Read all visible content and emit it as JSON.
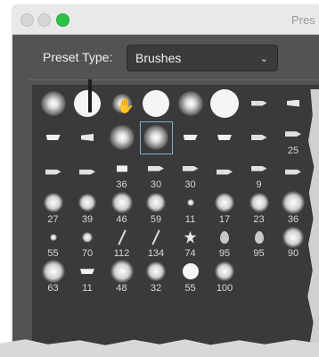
{
  "window": {
    "title": "Pres"
  },
  "preset": {
    "label": "Preset Type:",
    "value": "Brushes"
  },
  "brushes": [
    {
      "shape": "soft",
      "size": 28,
      "num": ""
    },
    {
      "shape": "hard",
      "size": 30,
      "num": ""
    },
    {
      "shape": "soft",
      "size": 22,
      "num": ""
    },
    {
      "shape": "hard",
      "size": 30,
      "num": ""
    },
    {
      "shape": "soft",
      "size": 28,
      "num": ""
    },
    {
      "shape": "hard",
      "size": 32,
      "num": ""
    },
    {
      "shape": "tip-c",
      "size": 0,
      "num": ""
    },
    {
      "shape": "tip-b",
      "size": 0,
      "num": ""
    },
    {
      "shape": "tip-a",
      "size": 0,
      "num": ""
    },
    {
      "shape": "tip-b",
      "size": 0,
      "num": ""
    },
    {
      "shape": "soft",
      "size": 28,
      "num": ""
    },
    {
      "shape": "soft",
      "size": 28,
      "num": "",
      "selected": true
    },
    {
      "shape": "tip-a",
      "size": 0,
      "num": ""
    },
    {
      "shape": "tip-a",
      "size": 0,
      "num": ""
    },
    {
      "shape": "tip-c",
      "size": 0,
      "num": ""
    },
    {
      "shape": "tip-c",
      "size": 0,
      "num": "25"
    },
    {
      "shape": "tip-c",
      "size": 0,
      "num": ""
    },
    {
      "shape": "tip-c",
      "size": 0,
      "num": ""
    },
    {
      "shape": "tip-d",
      "size": 0,
      "num": "36"
    },
    {
      "shape": "tip-c",
      "size": 0,
      "num": "30"
    },
    {
      "shape": "tip-c",
      "size": 0,
      "num": "30"
    },
    {
      "shape": "tip-c",
      "size": 0,
      "num": ""
    },
    {
      "shape": "tip-c",
      "size": 0,
      "num": "9"
    },
    {
      "shape": "tip-c",
      "size": 0,
      "num": ""
    },
    {
      "shape": "splat",
      "size": 22,
      "num": "27"
    },
    {
      "shape": "splat",
      "size": 20,
      "num": "39"
    },
    {
      "shape": "splat",
      "size": 24,
      "num": "46"
    },
    {
      "shape": "splat",
      "size": 22,
      "num": "59"
    },
    {
      "shape": "splat",
      "size": 8,
      "num": "11"
    },
    {
      "shape": "splat",
      "size": 22,
      "num": "17"
    },
    {
      "shape": "splat",
      "size": 22,
      "num": "23"
    },
    {
      "shape": "splat",
      "size": 26,
      "num": "36"
    },
    {
      "shape": "splat",
      "size": 8,
      "num": "55"
    },
    {
      "shape": "splat",
      "size": 12,
      "num": "70"
    },
    {
      "shape": "stroke",
      "size": 0,
      "num": "112"
    },
    {
      "shape": "stroke",
      "size": 0,
      "num": "134"
    },
    {
      "shape": "leaf",
      "size": 0,
      "num": "74"
    },
    {
      "shape": "drop",
      "size": 0,
      "num": "95"
    },
    {
      "shape": "drop",
      "size": 0,
      "num": "95"
    },
    {
      "shape": "splat",
      "size": 24,
      "num": "90"
    },
    {
      "shape": "splat",
      "size": 26,
      "num": "63"
    },
    {
      "shape": "tip-a",
      "size": 0,
      "num": "11"
    },
    {
      "shape": "splat",
      "size": 26,
      "num": "48"
    },
    {
      "shape": "splat",
      "size": 22,
      "num": "32"
    },
    {
      "shape": "hard",
      "size": 18,
      "num": "55"
    },
    {
      "shape": "splat",
      "size": 22,
      "num": "100"
    }
  ]
}
